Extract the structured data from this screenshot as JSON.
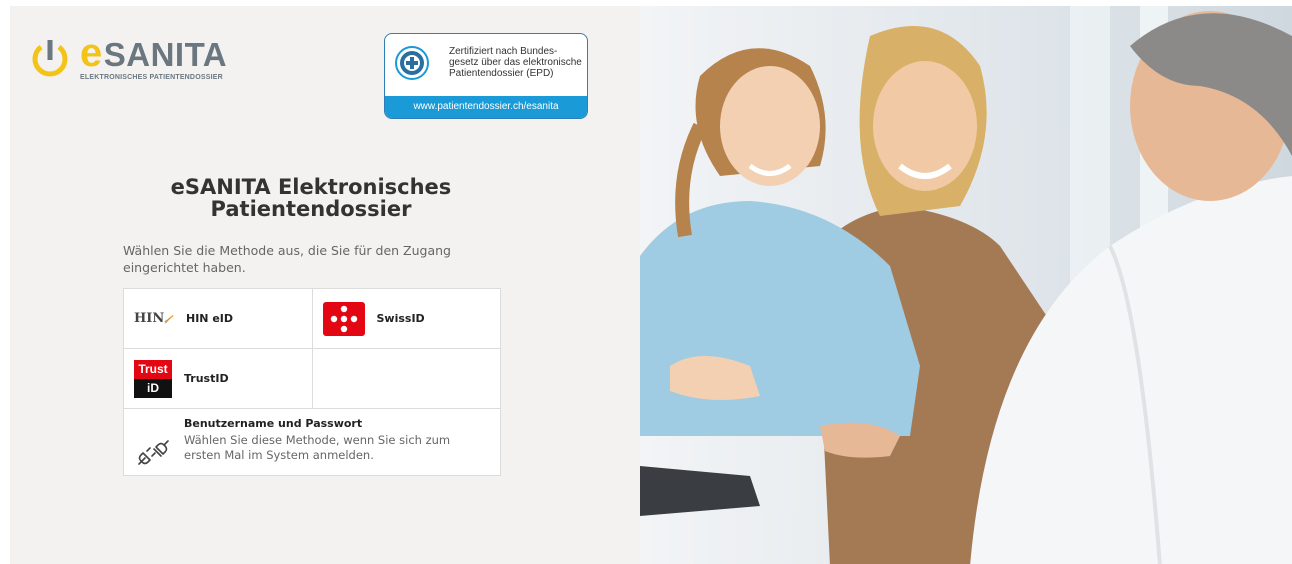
{
  "brand": {
    "name_e": "e",
    "name_rest": "SANITA",
    "subtitle": "ELEKTRONISCHES PATIENTENDOSSIER",
    "accent": "#f3c318",
    "gray": "#6a7780"
  },
  "certification": {
    "lines": [
      "Zertifiziert nach Bundes-",
      "gesetz über das elektronische",
      "Patientendossier (EPD)"
    ],
    "link": "www.patientendossier.ch/esanita",
    "color": "#1a9ad6",
    "icon": "epd-cross-icon"
  },
  "main": {
    "title": "eSANITA Elektronisches Patientendossier",
    "intro": "Wählen Sie die Methode aus, die Sie für den Zugang eingerichtet haben."
  },
  "login_methods": {
    "hin": {
      "logo_text": "HIN",
      "label": "HIN eID"
    },
    "swissid": {
      "label": "SwissID",
      "icon": "swissid-dots-icon",
      "color": "#e30613"
    },
    "trustid": {
      "logo_top": "Trust",
      "logo_bottom": "iD",
      "label": "TrustID"
    },
    "password": {
      "title": "Benutzername und Passwort",
      "description": "Wählen Sie diese Methode, wenn Sie sich zum ersten Mal im System anmelden.",
      "icon": "plug-icon"
    }
  }
}
